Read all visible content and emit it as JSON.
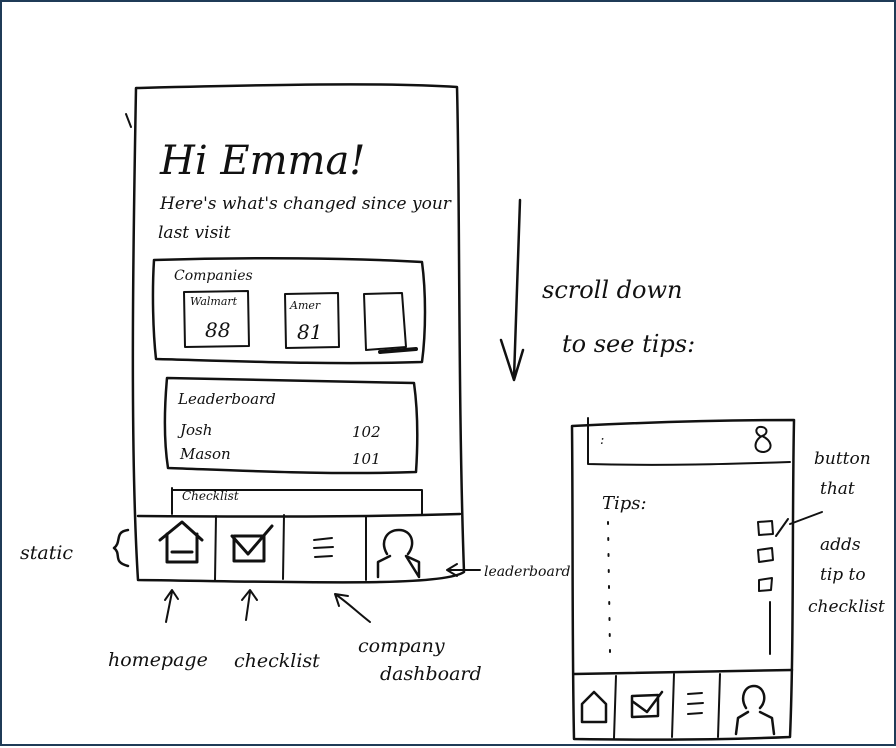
{
  "phone_main": {
    "greeting": "Hi Emma!",
    "subtitle_line1": "Here's what's changed since your",
    "subtitle_line2": "last visit",
    "companies": {
      "title": "Companies",
      "cards": [
        {
          "name": "Walmart",
          "score": "88"
        },
        {
          "name": "Amer",
          "score": "81"
        },
        {
          "name": "",
          "score": ""
        }
      ]
    },
    "leaderboard": {
      "title": "Leaderboard",
      "rows": [
        {
          "name": "Josh",
          "score": "102"
        },
        {
          "name": "Mason",
          "score": "101"
        }
      ]
    },
    "checklist_peek": "Checklist",
    "tabs": [
      {
        "icon": "home-icon"
      },
      {
        "icon": "checkbox-icon"
      },
      {
        "icon": "menu-lines-icon"
      },
      {
        "icon": "person-icon"
      }
    ]
  },
  "phone_tips": {
    "tips_label": "Tips:",
    "top_bar_dot": ":",
    "tabs": [
      {
        "icon": "home-icon"
      },
      {
        "icon": "checkbox-icon"
      },
      {
        "icon": "menu-lines-icon"
      },
      {
        "icon": "person-icon"
      }
    ]
  },
  "annotations": {
    "scroll_line1": "scroll down",
    "scroll_line2": "to see tips:",
    "static": "static",
    "leaderboard": "leaderboard",
    "homepage": "homepage",
    "checklist": "checklist",
    "company_line1": "company",
    "company_line2": "dashboard",
    "button_line1": "button",
    "button_line2": "that",
    "adds_line1": "adds",
    "adds_line2": "tip to",
    "adds_line3": "checklist"
  }
}
